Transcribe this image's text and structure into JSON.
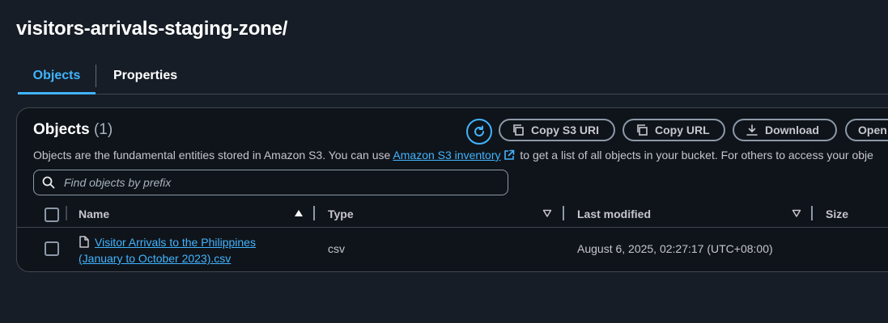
{
  "page": {
    "title": "visitors-arrivals-staging-zone/"
  },
  "tabs": [
    {
      "label": "Objects",
      "active": true
    },
    {
      "label": "Properties",
      "active": false
    }
  ],
  "objects_panel": {
    "heading": "Objects",
    "count": "(1)",
    "description_before": "Objects are the fundamental entities stored in Amazon S3. You can use ",
    "description_link": "Amazon S3 inventory",
    "description_after": " to get a list of all objects in your bucket. For others to access your obje",
    "search_placeholder": "Find objects by prefix",
    "buttons": {
      "refresh_icon": "refresh-icon",
      "copy_uri": "Copy S3 URI",
      "copy_url": "Copy URL",
      "download": "Download",
      "open": "Open"
    },
    "columns": {
      "name": "Name",
      "type": "Type",
      "last_modified": "Last modified",
      "size": "Size"
    },
    "rows": [
      {
        "name_line1": "Visitor Arrivals to the Philippines",
        "name_line2": "(January to October 2023).csv",
        "type": "csv",
        "last_modified": "August 6, 2025, 02:27:17 (UTC+08:00)"
      }
    ]
  },
  "colors": {
    "accent": "#42b4ff",
    "background": "#161d26",
    "panel": "#0f141a",
    "border": "#424650"
  }
}
